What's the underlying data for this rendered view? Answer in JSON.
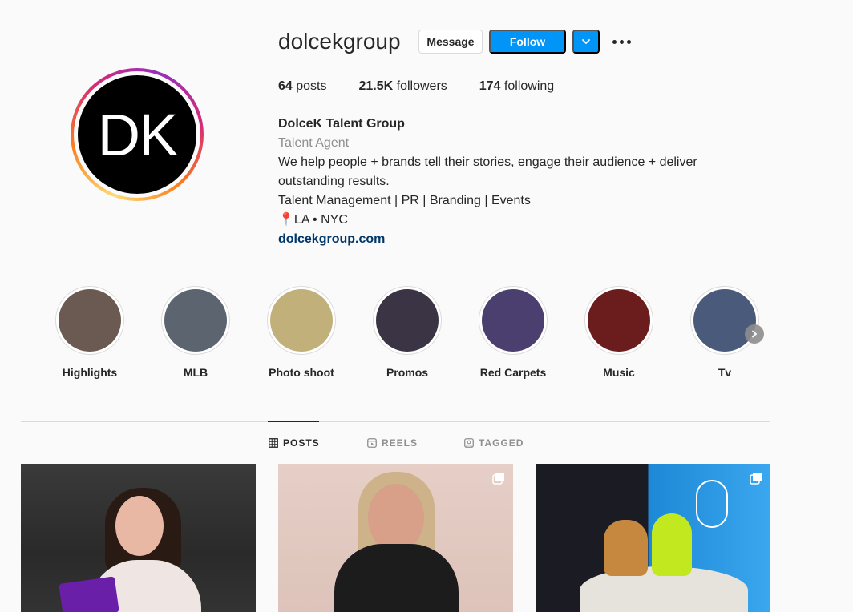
{
  "profile": {
    "username": "dolcekgroup",
    "avatar_initials": "DK",
    "buttons": {
      "message": "Message",
      "follow": "Follow"
    },
    "stats": {
      "posts_count": "64",
      "posts_label": " posts",
      "followers_count": "21.5K",
      "followers_label": " followers",
      "following_count": "174",
      "following_label": " following"
    },
    "bio": {
      "name": "DolceK Talent Group",
      "category": "Talent Agent",
      "line1": "We help people + brands tell their stories, engage their audience + deliver outstanding results.",
      "line2": "Talent Management | PR | Branding | Events",
      "line3": "📍LA • NYC",
      "website": "dolcekgroup.com"
    }
  },
  "highlights": [
    {
      "label": "Highlights",
      "color": "#6b5a52"
    },
    {
      "label": "MLB",
      "color": "#5c6470"
    },
    {
      "label": "Photo shoot",
      "color": "#c2b07a"
    },
    {
      "label": "Promos",
      "color": "#3b3445"
    },
    {
      "label": "Red Carpets",
      "color": "#4a3f6e"
    },
    {
      "label": "Music",
      "color": "#6b1c1c"
    },
    {
      "label": "Tv",
      "color": "#4a5a7a"
    }
  ],
  "tabs": [
    {
      "label": "POSTS",
      "icon": "grid-icon",
      "active": true
    },
    {
      "label": "REELS",
      "icon": "reels-icon",
      "active": false
    },
    {
      "label": "TAGGED",
      "icon": "tagged-icon",
      "active": false
    }
  ],
  "colors": {
    "accent": "#0095f6",
    "link": "#00376b",
    "muted": "#8e8e8e"
  }
}
